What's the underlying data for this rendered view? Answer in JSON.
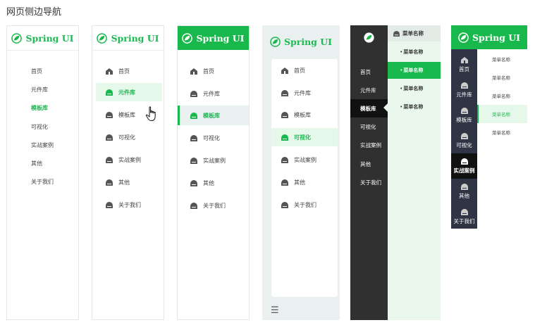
{
  "page_title": "网页侧边导航",
  "brand": "Spring UI",
  "menu": [
    "首页",
    "元件库",
    "模板库",
    "可视化",
    "实战案例",
    "其他",
    "关于我们"
  ],
  "variant1": {
    "active_index": 2
  },
  "variant2": {
    "active_index": 1
  },
  "variant3": {
    "active_index": 2
  },
  "variant4": {
    "active_index": 3,
    "collapse_icon": "☰"
  },
  "variant5": {
    "active_index": 2,
    "submenu_title": "菜单名称",
    "submenu": [
      "• 菜单名称",
      "• 菜单名称",
      "• 菜单名称",
      "• 菜单名称"
    ],
    "submenu_active_index": 1
  },
  "variant6": {
    "active_index": 4,
    "submenu": [
      "菜单名称",
      "菜单名称",
      "菜单名称",
      "菜单名称",
      "菜单名称"
    ],
    "submenu_active_index": 3
  },
  "colors": {
    "accent": "#19b84c",
    "dark": "#303030",
    "rail": "#303546",
    "active_bg": "#e6f8ea"
  }
}
